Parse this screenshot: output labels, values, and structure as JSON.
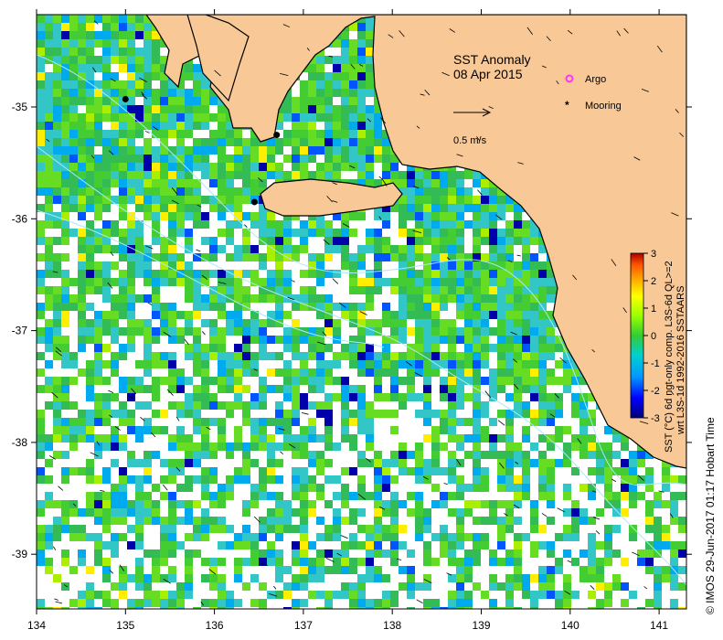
{
  "map": {
    "title": "SST Anomaly",
    "date": "08 Apr 2015",
    "colors": {
      "land": "#f8c896",
      "coast": "#000000",
      "no_data": "#ffffff",
      "contour": "#a8e8ff",
      "argo": "#ff33ff",
      "mooring": "#000000"
    },
    "x_ticks": [
      "134",
      "135",
      "136",
      "137",
      "138",
      "139",
      "140",
      "141"
    ],
    "y_ticks": [
      "-35",
      "-36",
      "-37",
      "-38",
      "-39"
    ],
    "legend": {
      "argo_label": "Argo",
      "mooring_label": "Mooring"
    },
    "scale_label": "0.5 m/s",
    "moorings": [
      {
        "lon": 135.0,
        "lat": -34.93
      },
      {
        "lon": 136.7,
        "lat": -35.25
      },
      {
        "lon": 136.45,
        "lat": -35.85
      }
    ]
  },
  "colorbar": {
    "ticks": [
      "3",
      "2",
      "1",
      "0",
      "-1",
      "-2",
      "-3"
    ],
    "colors": [
      "#00007a",
      "#0000ff",
      "#0099ff",
      "#00d0d0",
      "#33cc33",
      "#99ff00",
      "#ffff00",
      "#ffaa00",
      "#ff5500",
      "#aa0000"
    ],
    "caption_1": "SST (°C) 6d ngt-only comp. L3S-6d QL>=2",
    "caption_2": "wrt L3S-1d 1992-2016 SSTAARS"
  },
  "footer": {
    "credit": "© IMOS 29-Jun-2017 01:17 Hobart Time"
  }
}
